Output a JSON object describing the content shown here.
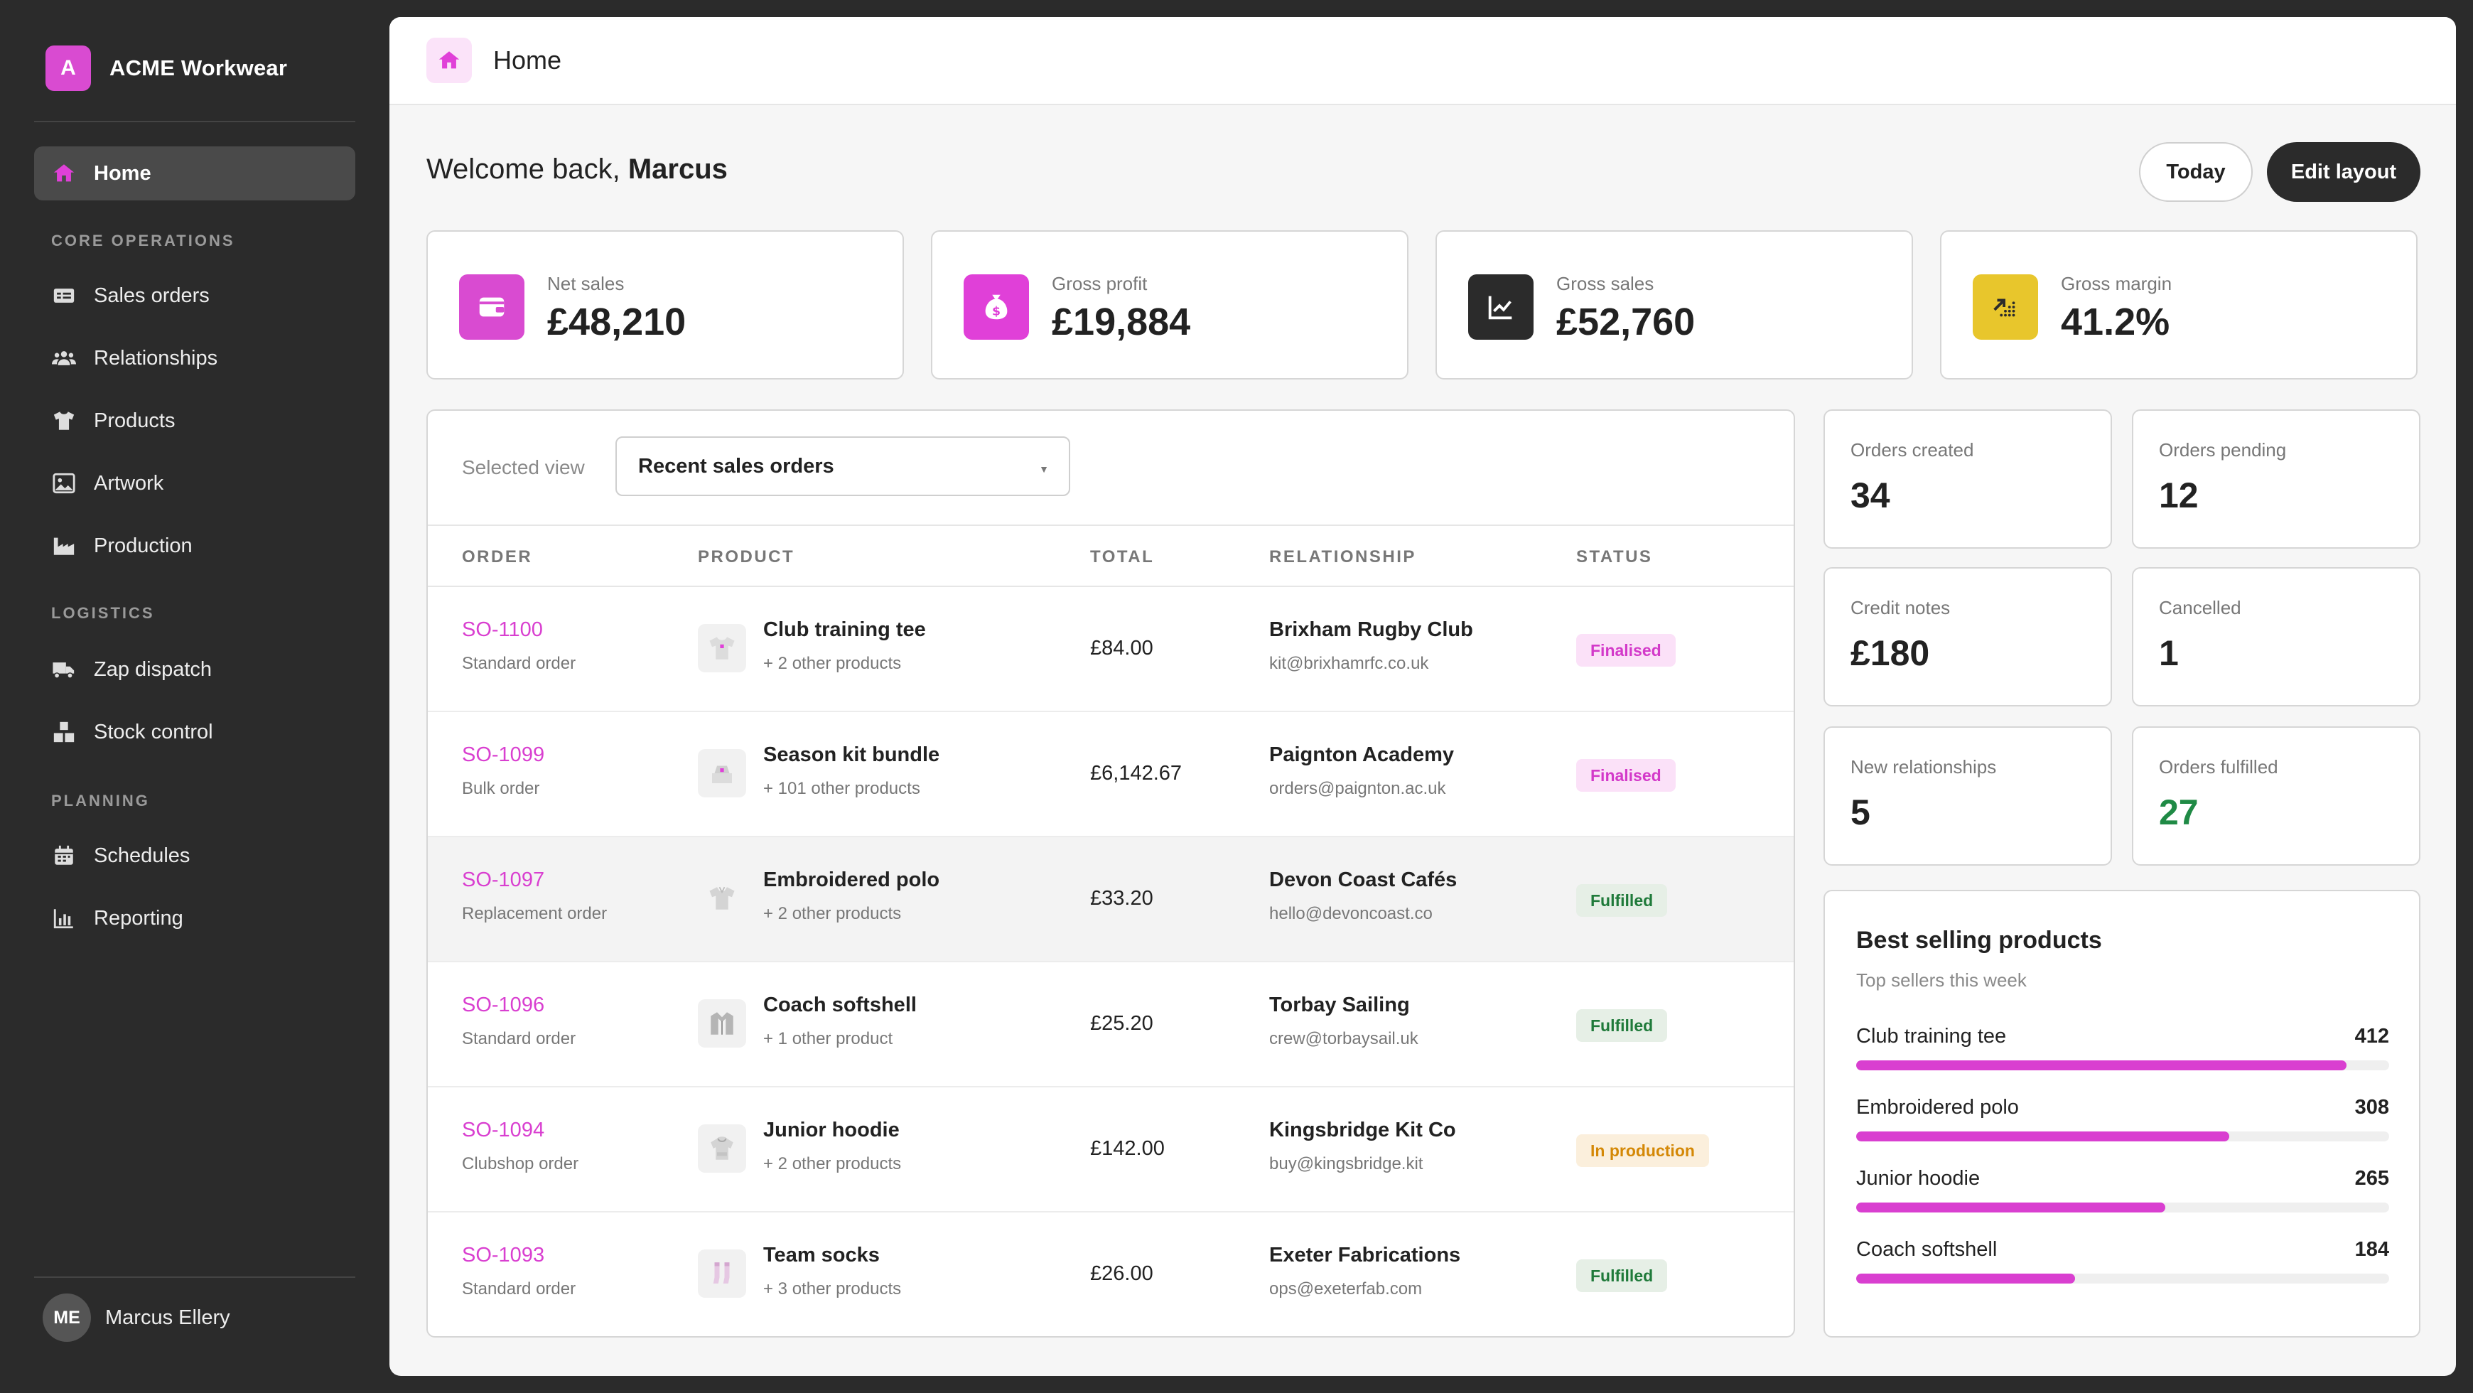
{
  "app": {
    "brand_initial": "A",
    "brand_name": "ACME Workwear",
    "accent_color": "#d93fd0"
  },
  "sidebar": {
    "home": {
      "label": "Home",
      "icon": "home-icon",
      "active": true
    },
    "sections": [
      {
        "title": "CORE OPERATIONS",
        "items": [
          {
            "label": "Sales orders",
            "icon": "sales-orders-icon"
          },
          {
            "label": "Relationships",
            "icon": "people-icon"
          },
          {
            "label": "Products",
            "icon": "tshirt-icon"
          },
          {
            "label": "Artwork",
            "icon": "image-icon"
          },
          {
            "label": "Production",
            "icon": "factory-icon"
          }
        ]
      },
      {
        "title": "LOGISTICS",
        "items": [
          {
            "label": "Zap dispatch",
            "icon": "truck-icon"
          },
          {
            "label": "Stock control",
            "icon": "boxes-icon"
          }
        ]
      },
      {
        "title": "PLANNING",
        "items": [
          {
            "label": "Schedules",
            "icon": "calendar-icon"
          },
          {
            "label": "Reporting",
            "icon": "bar-chart-icon"
          }
        ]
      }
    ],
    "user": {
      "initials": "ME",
      "name": "Marcus Ellery"
    }
  },
  "topbar": {
    "title": "Home",
    "icon": "home-icon"
  },
  "header": {
    "welcome_prefix": "Welcome back, ",
    "welcome_name": "Marcus",
    "today_label": "Today",
    "edit_layout_label": "Edit layout"
  },
  "kpis": [
    {
      "label": "Net sales",
      "value": "£48,210",
      "icon": "wallet-icon",
      "icon_bg": "#d94bd1"
    },
    {
      "label": "Gross profit",
      "value": "£19,884",
      "icon": "money-bag-icon",
      "icon_bg": "#e040d8"
    },
    {
      "label": "Gross sales",
      "value": "£52,760",
      "icon": "line-chart-icon",
      "icon_bg": "#2b2b2b"
    },
    {
      "label": "Gross margin",
      "value": "41.2%",
      "icon": "trend-up-icon",
      "icon_bg": "#e8c62c"
    }
  ],
  "orders_table": {
    "selected_view_label": "Selected view",
    "selected_view_value": "Recent sales orders",
    "columns": [
      "ORDER",
      "PRODUCT",
      "TOTAL",
      "RELATIONSHIP",
      "STATUS"
    ],
    "rows": [
      {
        "order_id": "SO-1100",
        "order_type": "Standard order",
        "product": "Club training tee",
        "product_more": "+ 2 other products",
        "product_icon": "tshirt-icon",
        "total": "£84.00",
        "relationship": "Brixham Rugby Club",
        "email": "kit@brixhamrfc.co.uk",
        "status": "Finalised"
      },
      {
        "order_id": "SO-1099",
        "order_type": "Bulk order",
        "product": "Season kit bundle",
        "product_more": "+ 101 other products",
        "product_icon": "bundle-icon",
        "total": "£6,142.67",
        "relationship": "Paignton Academy",
        "email": "orders@paignton.ac.uk",
        "status": "Finalised"
      },
      {
        "order_id": "SO-1097",
        "order_type": "Replacement order",
        "product": "Embroidered polo",
        "product_more": "+ 2 other products",
        "product_icon": "polo-icon",
        "total": "£33.20",
        "relationship": "Devon Coast Cafés",
        "email": "hello@devoncoast.co",
        "status": "Fulfilled"
      },
      {
        "order_id": "SO-1096",
        "order_type": "Standard order",
        "product": "Coach softshell",
        "product_more": "+ 1 other product",
        "product_icon": "jacket-icon",
        "total": "£25.20",
        "relationship": "Torbay Sailing",
        "email": "crew@torbaysail.uk",
        "status": "Fulfilled"
      },
      {
        "order_id": "SO-1094",
        "order_type": "Clubshop order",
        "product": "Junior hoodie",
        "product_more": "+ 2 other products",
        "product_icon": "hoodie-icon",
        "total": "£142.00",
        "relationship": "Kingsbridge Kit Co",
        "email": "buy@kingsbridge.kit",
        "status": "In production"
      },
      {
        "order_id": "SO-1093",
        "order_type": "Standard order",
        "product": "Team socks",
        "product_more": "+ 3 other products",
        "product_icon": "socks-icon",
        "total": "£26.00",
        "relationship": "Exeter Fabrications",
        "email": "ops@exeterfab.com",
        "status": "Fulfilled"
      }
    ]
  },
  "stats": [
    {
      "label": "Orders created",
      "value": "34"
    },
    {
      "label": "Orders pending",
      "value": "12"
    },
    {
      "label": "Credit notes",
      "value": "£180"
    },
    {
      "label": "Cancelled",
      "value": "1"
    },
    {
      "label": "New relationships",
      "value": "5"
    },
    {
      "label": "Orders fulfilled",
      "value": "27",
      "highlight_color": "#1f8a45"
    }
  ],
  "best_sellers": {
    "title": "Best selling products",
    "subtitle": "Top sellers this week",
    "items": [
      {
        "name": "Club training tee",
        "value": "412",
        "fill": 0.92
      },
      {
        "name": "Embroidered polo",
        "value": "308",
        "fill": 0.7
      },
      {
        "name": "Junior hoodie",
        "value": "265",
        "fill": 0.58
      },
      {
        "name": "Coach softshell",
        "value": "184",
        "fill": 0.41
      }
    ]
  }
}
